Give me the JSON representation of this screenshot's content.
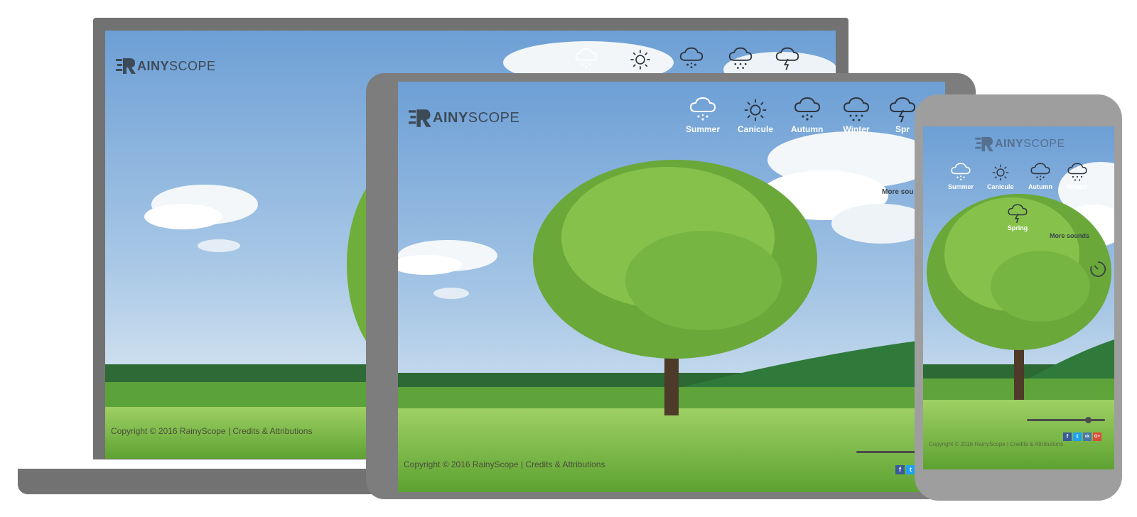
{
  "brand": {
    "logo_bold": "AINY",
    "logo_light": "SCOPE",
    "logo_letter": "R"
  },
  "colors": {
    "sky_top": "#6fa3d8",
    "sky_bottom": "#c7dcef",
    "grass": "#7cc24a",
    "frame_dark": "#727272",
    "frame_phone": "#9e9e9e"
  },
  "laptop": {
    "nav_icons": [
      "rain-cloud-icon",
      "sun-icon",
      "cloud-icon",
      "snow-cloud-icon",
      "storm-cloud-icon"
    ],
    "footer": {
      "copyright": "Copyright © 2016 RainyScope",
      "separator": "|",
      "credits": "Credits & Attributions"
    }
  },
  "tablet": {
    "nav": [
      {
        "label": "Summer",
        "icon": "rain-cloud-icon"
      },
      {
        "label": "Canicule",
        "icon": "sun-icon"
      },
      {
        "label": "Autumn",
        "icon": "cloud-icon"
      },
      {
        "label": "Winter",
        "icon": "snow-cloud-icon"
      },
      {
        "label": "Spr",
        "icon": "storm-cloud-icon"
      }
    ],
    "more_sounds": "More sou",
    "footer": {
      "copyright": "Copyright © 2016 RainyScope",
      "separator": "|",
      "credits": "Credits & Attributions"
    }
  },
  "phone": {
    "nav": [
      {
        "label": "Summer",
        "icon": "rain-cloud-icon"
      },
      {
        "label": "Canicule",
        "icon": "sun-icon"
      },
      {
        "label": "Autumn",
        "icon": "cloud-icon"
      },
      {
        "label": "Winter",
        "icon": "snow-cloud-icon"
      },
      {
        "label": "Spring",
        "icon": "storm-cloud-icon"
      }
    ],
    "more_sounds": "More sounds",
    "timer_icon": "timer-icon",
    "volume_level": 0.78,
    "social": [
      "f",
      "t",
      "vk",
      "G+"
    ],
    "footer": {
      "copyright": "Copyright © 2016 RainyScope",
      "separator": "|",
      "credits": "Credits & Attributions"
    }
  }
}
